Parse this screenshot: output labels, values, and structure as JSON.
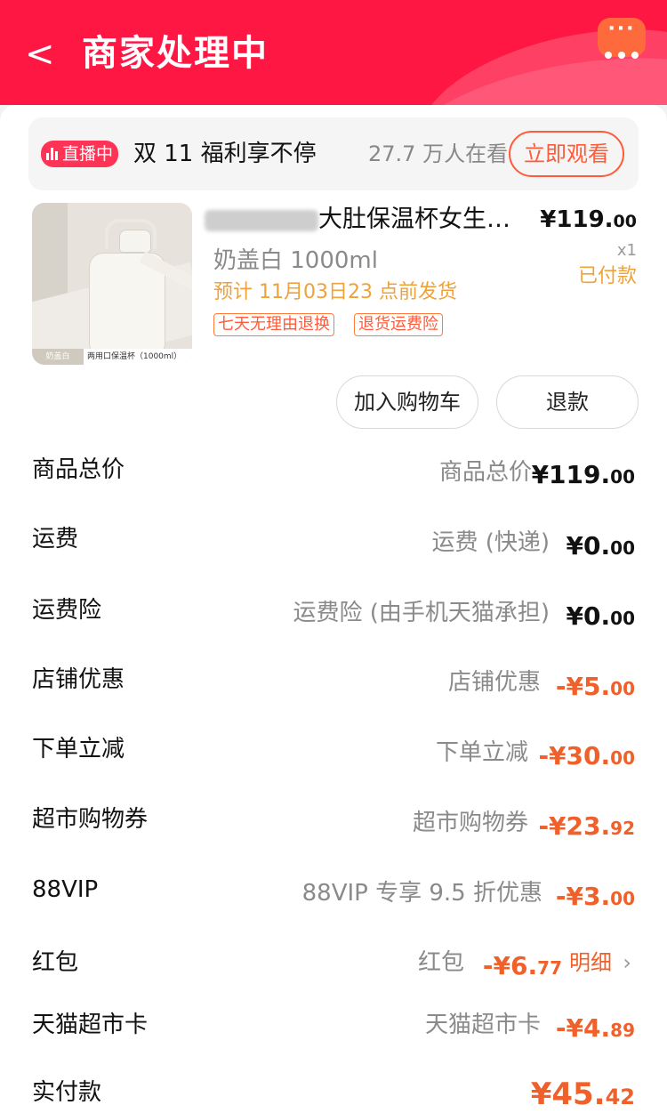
{
  "header": {
    "back": "<",
    "title": "商家处理中",
    "more": "···"
  },
  "live": {
    "badge": "直播中",
    "text": "双 11 福利享不停",
    "viewers": "27.7 万人在看",
    "watch_button": "立即观看"
  },
  "product": {
    "name": "大肚保温杯女生…",
    "price_int": "¥119.",
    "price_dec": "00",
    "sku": "奶盖白 1000ml",
    "qty": "x1",
    "status": "已付款",
    "ship": "预计 11月03日23 点前发货",
    "tags": [
      "七天无理由退换",
      "退货运费险"
    ],
    "image_caption_left": "奶盖白",
    "image_caption_right": "两用口保温杯（1000ml）"
  },
  "actions": {
    "add_cart": "加入购物车",
    "refund": "退款"
  },
  "rows": [
    {
      "label": "商品总价",
      "desc": "商品总价",
      "int": "¥119.",
      "dec": "00"
    },
    {
      "label": "运费",
      "desc": "运费 (快递)",
      "int": "¥0.",
      "dec": "00"
    },
    {
      "label": "运费险",
      "desc": "运费险 (由手机天猫承担)",
      "int": "¥0.",
      "dec": "00"
    },
    {
      "label": "店铺优惠",
      "desc": "店铺优惠",
      "int": "-¥5.",
      "dec": "00"
    },
    {
      "label": "下单立减",
      "desc": "下单立减",
      "int": "-¥30.",
      "dec": "00"
    },
    {
      "label": "超市购物券",
      "desc": "超市购物券",
      "int": "-¥23.",
      "dec": "92"
    },
    {
      "label": "88VIP",
      "desc": "88VIP 专享 9.5 折优惠",
      "int": "-¥3.",
      "dec": "00"
    },
    {
      "label": "红包",
      "desc": "红包",
      "int": "-¥6.",
      "dec": "77",
      "link": "明细"
    },
    {
      "label": "天猫超市卡",
      "desc": "天猫超市卡",
      "int": "-¥4.",
      "dec": "89"
    }
  ],
  "total": {
    "label": "实付款",
    "int": "¥45.",
    "dec": "42"
  },
  "colors": {
    "header": "#ff1744",
    "accent": "#f0602a",
    "ship": "#f0a23a"
  }
}
